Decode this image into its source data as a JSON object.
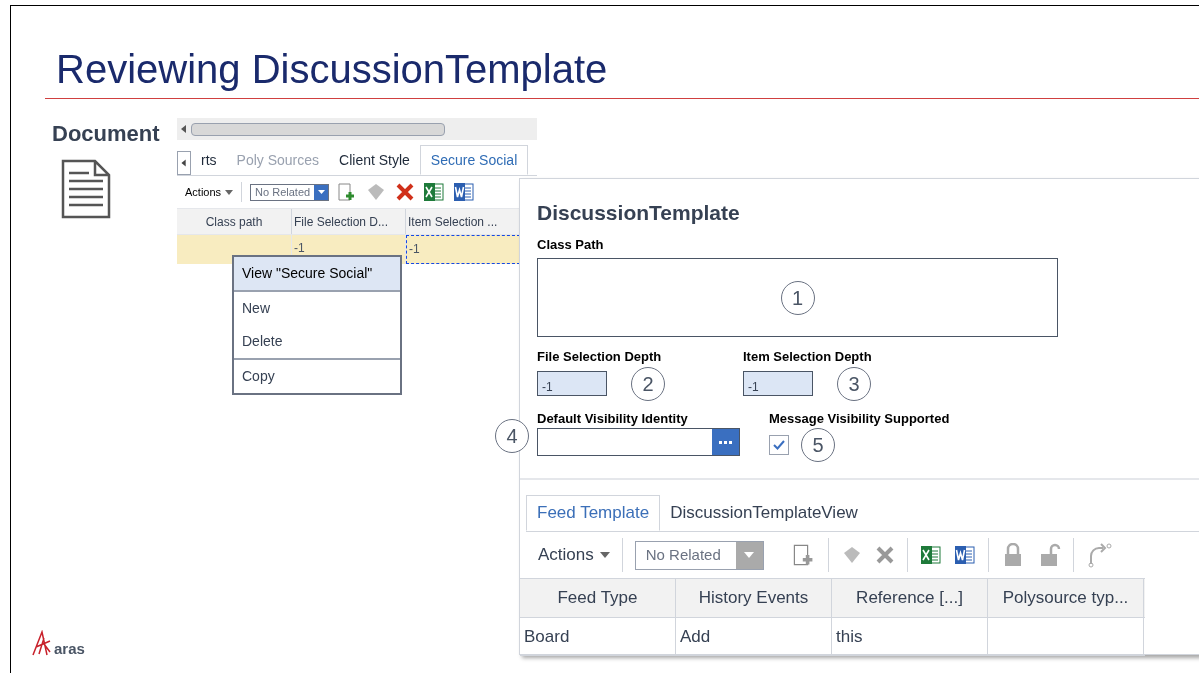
{
  "slide": {
    "title": "Reviewing DiscussionTemplate",
    "item_type": "Document",
    "logo": "aras"
  },
  "back_view": {
    "tabs": [
      {
        "label": "rts",
        "selected": false,
        "disabled": false
      },
      {
        "label": "Poly Sources",
        "selected": false,
        "disabled": true
      },
      {
        "label": "Client Style",
        "selected": false,
        "disabled": false
      },
      {
        "label": "Secure Social",
        "selected": true,
        "disabled": false
      }
    ],
    "toolbar": {
      "actions": "Actions",
      "related": "No Related"
    },
    "columns": [
      "Class path",
      "File Selection D...",
      "Item Selection ..."
    ],
    "row": {
      "selected": true,
      "cells": [
        "-1",
        "-1"
      ]
    },
    "context_menu": [
      {
        "label": "View \"Secure Social\"",
        "selected": true,
        "separator_before": false
      },
      {
        "label": "New",
        "selected": false,
        "separator_before": true
      },
      {
        "label": "Delete",
        "selected": false,
        "separator_before": false
      },
      {
        "label": "Copy",
        "selected": false,
        "separator_before": true
      }
    ]
  },
  "form": {
    "title": "DiscussionTemplate",
    "fields": [
      {
        "kind": "textarea",
        "label": "Class Path",
        "callout": "1"
      },
      {
        "kind": "number",
        "label": "File Selection Depth",
        "value": "-1",
        "callout": "2"
      },
      {
        "kind": "number",
        "label": "Item Selection Depth",
        "value": "-1",
        "callout": "3"
      },
      {
        "kind": "picker",
        "label": "Default Visibility Identity",
        "callout": "4"
      },
      {
        "kind": "checkbox",
        "label": "Message Visibility Supported",
        "checked": true,
        "callout": "5"
      }
    ]
  },
  "relationships": {
    "tabs": [
      {
        "label": "Feed Template",
        "selected": true
      },
      {
        "label": "DiscussionTemplateView",
        "selected": false
      }
    ],
    "toolbar": {
      "actions": "Actions",
      "related": "No Related"
    },
    "columns": [
      "Feed Type",
      "History Events",
      "Reference [...]",
      "Polysource typ..."
    ],
    "rows": [
      [
        "Board",
        "Add",
        "this"
      ]
    ]
  }
}
